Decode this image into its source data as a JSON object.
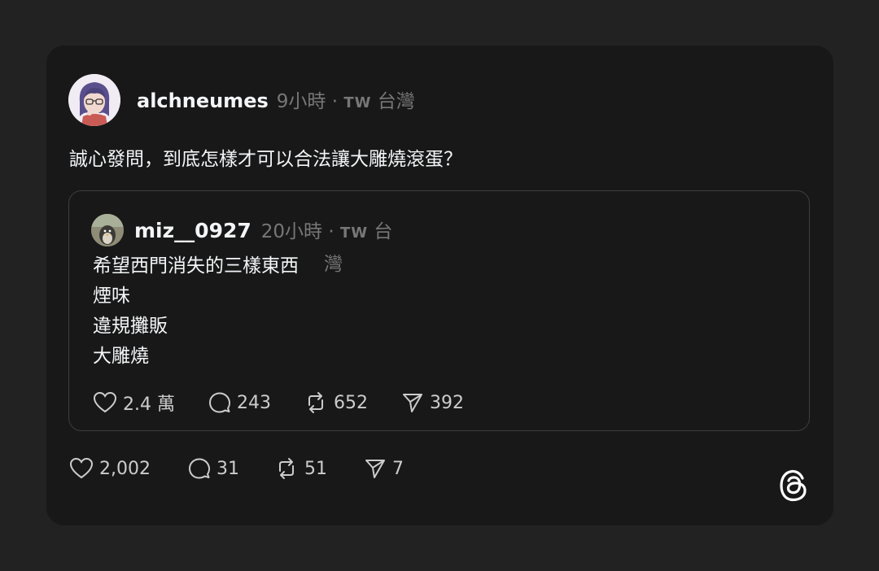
{
  "post": {
    "username": "alchneumes",
    "time": "9小時",
    "dot": "·",
    "country_code": "TW",
    "location": "台灣",
    "text": "誠心發問，到底怎樣才可以合法讓大雕燒滾蛋？"
  },
  "quoted_post": {
    "username": "miz__0927",
    "time": "20小時",
    "dot": "·",
    "country_code": "TW",
    "location_part1": "台",
    "location_part2": "灣",
    "lines": [
      "希望西門消失的三樣東西",
      "煙味",
      "違規攤販",
      "大雕燒"
    ],
    "stats": {
      "likes": "2.4 萬",
      "comments": "243",
      "reposts": "652",
      "shares": "392"
    }
  },
  "stats": {
    "likes": "2,002",
    "comments": "31",
    "reposts": "51",
    "shares": "7"
  },
  "icons": {
    "like": "heart-icon",
    "comment": "comment-bubble-icon",
    "repost": "repost-icon",
    "share": "send-icon",
    "brand": "threads-logo-icon"
  },
  "colors": {
    "background": "#222222",
    "card": "#181818",
    "text": "#f3f5f7",
    "muted": "#777777"
  }
}
